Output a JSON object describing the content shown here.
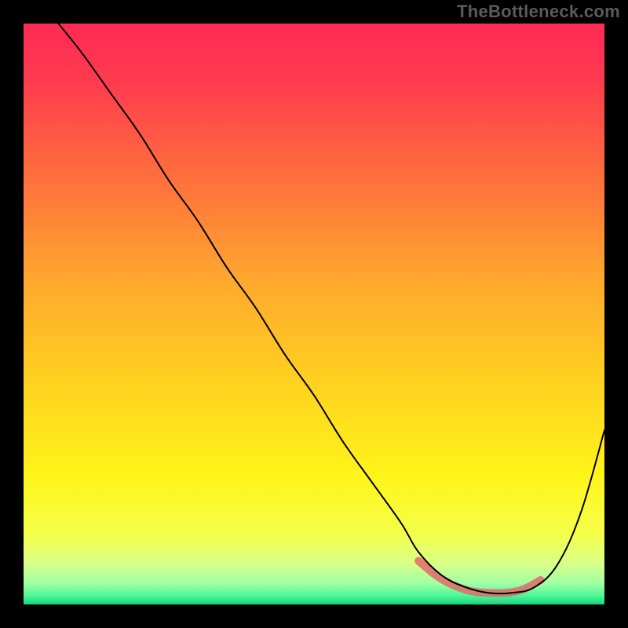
{
  "watermark": "TheBottleneck.com",
  "chart_data": {
    "type": "line",
    "title": "",
    "xlabel": "",
    "ylabel": "",
    "xlim": [
      0,
      100
    ],
    "ylim": [
      0,
      100
    ],
    "background_gradient_stops": [
      {
        "pos": 0.0,
        "color": "#ff2a55"
      },
      {
        "pos": 0.1,
        "color": "#ff3b4f"
      },
      {
        "pos": 0.25,
        "color": "#ff6a3e"
      },
      {
        "pos": 0.45,
        "color": "#ffaa2e"
      },
      {
        "pos": 0.62,
        "color": "#ffd21f"
      },
      {
        "pos": 0.78,
        "color": "#fff51a"
      },
      {
        "pos": 0.88,
        "color": "#f4ff4a"
      },
      {
        "pos": 0.93,
        "color": "#d9ff8a"
      },
      {
        "pos": 0.965,
        "color": "#9dffa5"
      },
      {
        "pos": 0.985,
        "color": "#4cf796"
      },
      {
        "pos": 1.0,
        "color": "#17d680"
      }
    ],
    "series": [
      {
        "name": "curve",
        "stroke": "#000000",
        "stroke_width": 2,
        "x": [
          6,
          10,
          15,
          20,
          25,
          30,
          35,
          40,
          45,
          50,
          55,
          60,
          65,
          68,
          72,
          76,
          80,
          84,
          88,
          92,
          96,
          100
        ],
        "y": [
          100,
          95,
          88,
          81,
          73,
          66,
          58,
          51,
          43,
          36,
          28,
          21,
          14,
          9,
          5,
          3,
          2,
          2,
          3,
          7,
          16,
          30
        ]
      },
      {
        "name": "highlight-band",
        "stroke": "#e06a6a",
        "stroke_width": 10,
        "opacity": 0.85,
        "x": [
          68,
          71,
          74,
          77,
          80,
          83,
          86,
          89
        ],
        "y": [
          7.5,
          5,
          3.3,
          2.3,
          2,
          2,
          2.6,
          4.2
        ]
      }
    ]
  }
}
